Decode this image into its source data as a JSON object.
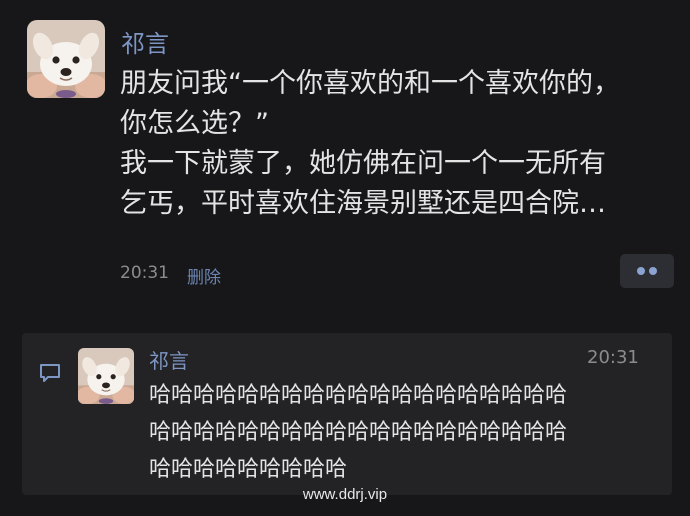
{
  "post": {
    "author": "祁言",
    "avatar_icon": "dog-avatar-icon",
    "lines": [
      "朋友问我“一个你喜欢的和一个喜欢你的，",
      "你怎么选？”",
      "我一下就蒙了，她仿佛在问一个一无所有",
      "乞丐，平时喜欢住海景别墅还是四合院…"
    ],
    "time": "20:31",
    "delete_label": "删除",
    "more_icon": "more-dots-icon"
  },
  "comment": {
    "icon": "comment-bubble-icon",
    "author": "祁言",
    "time": "20:31",
    "lines": [
      "哈哈哈哈哈哈哈哈哈哈哈哈哈哈哈哈哈哈哈",
      "哈哈哈哈哈哈哈哈哈哈哈哈哈哈哈哈哈哈哈",
      "哈哈哈哈哈哈哈哈哈"
    ]
  },
  "watermark": "www.ddrj.vip",
  "colors": {
    "background": "#17171a",
    "link": "#7e96c4",
    "text": "#e4e4e4",
    "muted": "#8c8c8c",
    "panel": "#232326"
  }
}
